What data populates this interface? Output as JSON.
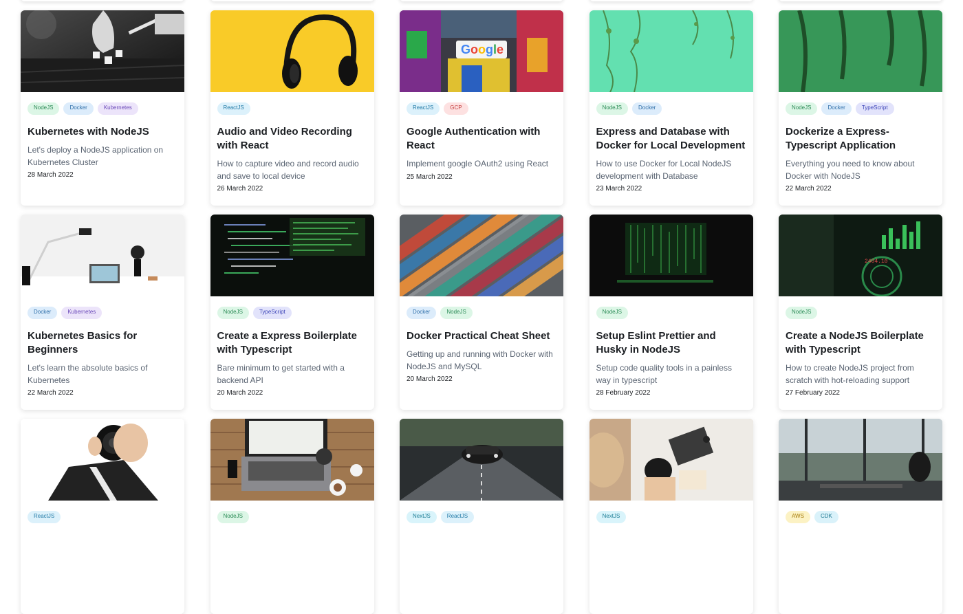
{
  "cards": [
    {
      "title": "Kubernetes with NodeJS",
      "desc": "Let's deploy a NodeJS application on Kubernetes Cluster",
      "date": "28 March 2022",
      "tags": [
        "NodeJS",
        "Docker",
        "Kubernetes"
      ],
      "image": "dice-photo"
    },
    {
      "title": "Audio and Video Recording with React",
      "desc": "How to capture video and record audio and save to local device",
      "date": "26 March 2022",
      "tags": [
        "ReactJS"
      ],
      "image": "headphones-photo"
    },
    {
      "title": "Google Authentication with React",
      "desc": "Implement google OAuth2 using React",
      "date": "25 March 2022",
      "tags": [
        "ReactJS",
        "GCP"
      ],
      "image": "google-sign-photo"
    },
    {
      "title": "Express and Database with Docker for Local Development",
      "desc": "How to use Docker for Local NodeJS development with Database",
      "date": "23 March 2022",
      "tags": [
        "NodeJS",
        "Docker"
      ],
      "image": "vines-wall-photo"
    },
    {
      "title": "Dockerize a Express-Typescript Application",
      "desc": "Everything you need to know about Docker with NodeJS",
      "date": "22 March 2022",
      "tags": [
        "NodeJS",
        "Docker",
        "TypeScript"
      ],
      "image": "green-wall-photo"
    },
    {
      "title": "Kubernetes Basics for Beginners",
      "desc": "Let's learn the absolute basics of Kubernetes",
      "date": "22 March 2022",
      "tags": [
        "Docker",
        "Kubernetes"
      ],
      "image": "desk-lamp-photo"
    },
    {
      "title": "Create a Express Boilerplate with Typescript",
      "desc": "Bare minimum to get started with a backend API",
      "date": "20 March 2022",
      "tags": [
        "NodeJS",
        "TypeScript"
      ],
      "image": "code-screen-photo"
    },
    {
      "title": "Docker Practical Cheat Sheet",
      "desc": "Getting up and running with Docker with NodeJS and MySQL",
      "date": "20 March 2022",
      "tags": [
        "Docker",
        "NodeJS"
      ],
      "image": "containers-aerial-photo"
    },
    {
      "title": "Setup Eslint Prettier and Husky in NodeJS",
      "desc": "Setup code quality tools in a painless way in typescript",
      "date": "28 February 2022",
      "tags": [
        "NodeJS"
      ],
      "image": "matrix-monitor-photo"
    },
    {
      "title": "Create a NodeJS Boilerplate with Typescript",
      "desc": "How to create NodeJS project from scratch with hot-reloading support",
      "date": "27 February 2022",
      "tags": [
        "NodeJS"
      ],
      "image": "dark-dashboard-photo"
    },
    {
      "title": "",
      "desc": "",
      "date": "",
      "tags": [
        "ReactJS"
      ],
      "image": "camera-lens-photo"
    },
    {
      "title": "",
      "desc": "",
      "date": "",
      "tags": [
        "NodeJS"
      ],
      "image": "laptop-desk-photo"
    },
    {
      "title": "",
      "desc": "",
      "date": "",
      "tags": [
        "NextJS",
        "ReactJS"
      ],
      "image": "racing-car-photo"
    },
    {
      "title": "",
      "desc": "",
      "date": "",
      "tags": [
        "NextJS"
      ],
      "image": "people-table-photo"
    },
    {
      "title": "",
      "desc": "",
      "date": "",
      "tags": [
        "AWS",
        "CDK"
      ],
      "image": "office-window-photo"
    }
  ]
}
